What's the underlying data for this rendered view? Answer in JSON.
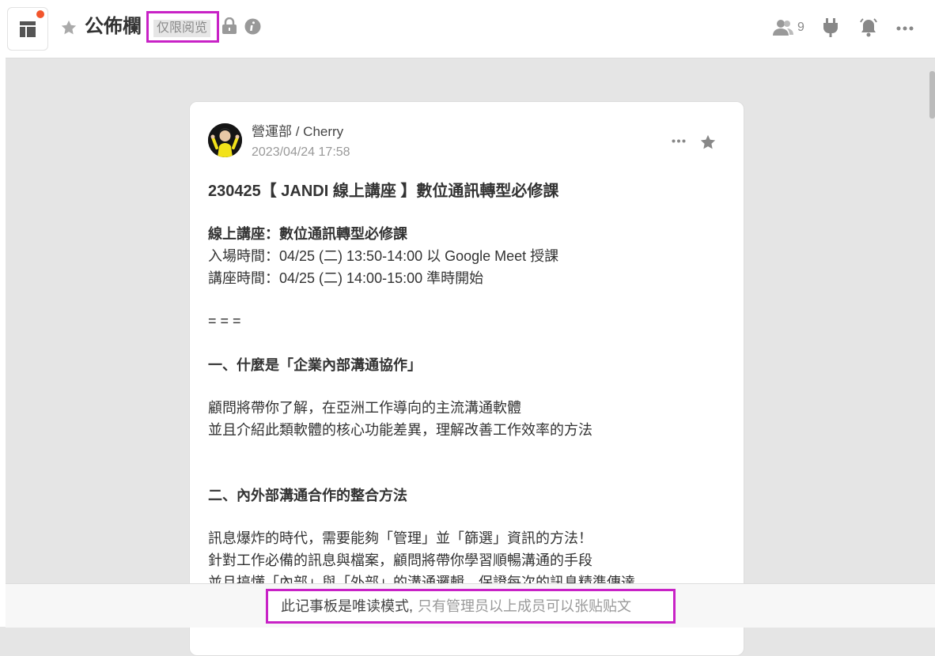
{
  "header": {
    "title": "公佈欄",
    "badge": "仅限阅览",
    "member_count": "9"
  },
  "post": {
    "author": "營運部 / Cherry",
    "timestamp": "2023/04/24 17:58",
    "title": "230425【 JANDI 線上講座 】數位通訊轉型必修課",
    "lines": [
      "線上講座：數位通訊轉型必修課",
      "入場時間：04/25 (二) 13:50-14:00 以 Google Meet 授課",
      "講座時間：04/25 (二) 14:00-15:00 準時開始",
      "= = =",
      "一、什麼是「企業內部溝通協作」",
      "顧問將帶你了解，在亞洲工作導向的主流溝通軟體",
      "並且介紹此類軟體的核心功能差異，理解改善工作效率的方法",
      "二、內外部溝通合作的整合方法",
      "訊息爆炸的時代，需要能夠「管理」並「篩選」資訊的方法！",
      "針對工作必備的訊息與檔案，顧問將帶你學習順暢溝通的手段",
      "並且搞懂「內部」與「外部」的溝通邏輯，保證每次的訊息精準傳達"
    ]
  },
  "notice": {
    "main": "此记事板是唯读模式,",
    "sub": "只有管理员以上成员可以张贴贴文"
  },
  "colors": {
    "highlight": "#c822c6",
    "notification_dot": "#f2552c"
  },
  "icons": [
    "panel-layout-icon",
    "star-icon",
    "lock-icon",
    "info-icon",
    "members-icon",
    "plug-icon",
    "bell-icon",
    "more-icon"
  ]
}
